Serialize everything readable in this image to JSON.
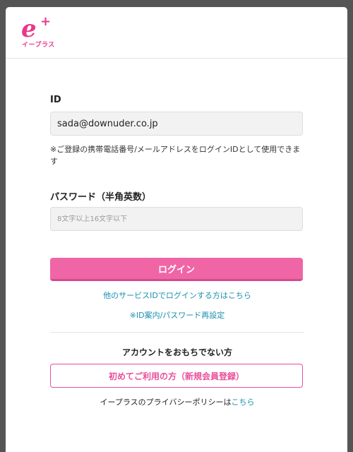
{
  "logo": {
    "mark": "e",
    "plus": "+",
    "kana": "イープラス"
  },
  "form": {
    "id_label": "ID",
    "id_value": "sada@downuder.co.jp",
    "id_note": "※ご登録の携帯電話番号/メールアドレスをログインIDとして使用できます",
    "password_label": "パスワード（半角英数）",
    "password_placeholder": "8文字以上16文字以下",
    "login_button": "ログイン"
  },
  "links": {
    "other_service": "他のサービスIDでログインする方はこちら",
    "reset": "※ID案内/パスワード再設定"
  },
  "signup": {
    "prompt": "アカウントをおもちでない方",
    "register_button": "初めてご利用の方（新規会員登録）"
  },
  "privacy": {
    "text": "イープラスのプライバシーポリシーは",
    "link": "こちら"
  },
  "colors": {
    "brand_pink": "#e8388a",
    "button_pink": "#f065a5",
    "link_blue": "#1a8fb0",
    "overlay": "#555555"
  }
}
